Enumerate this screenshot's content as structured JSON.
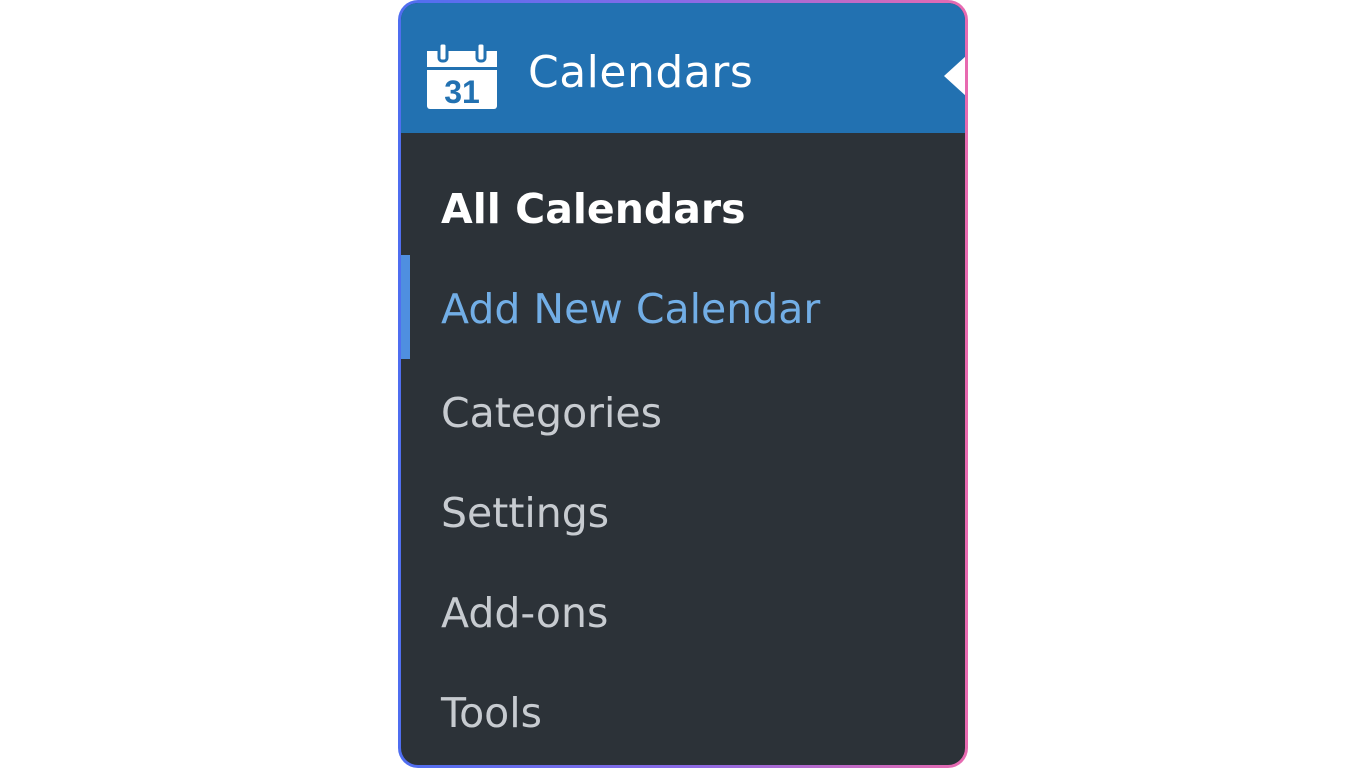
{
  "menu": {
    "title": "Calendars",
    "icon": "calendar-icon",
    "icon_day": "31",
    "header_color": "#2271b1",
    "background_color": "#2c3238",
    "accent_color": "#72aee6",
    "items": [
      {
        "label": "All Calendars",
        "state": "current"
      },
      {
        "label": "Add New Calendar",
        "state": "focused"
      },
      {
        "label": "Categories",
        "state": "normal"
      },
      {
        "label": "Settings",
        "state": "normal"
      },
      {
        "label": "Add-ons",
        "state": "normal"
      },
      {
        "label": "Tools",
        "state": "normal"
      }
    ]
  }
}
